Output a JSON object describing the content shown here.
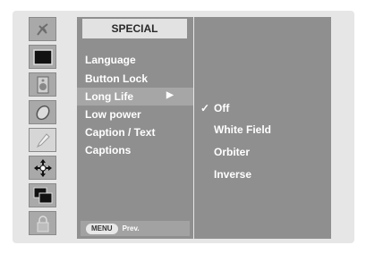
{
  "osd": {
    "menu_title": "SPECIAL",
    "menu_items": [
      {
        "label": "Language"
      },
      {
        "label": "Button Lock"
      },
      {
        "label": "Long Life",
        "arrow": "▶"
      },
      {
        "label": "Low power"
      },
      {
        "label": "Caption / Text"
      },
      {
        "label": "Captions"
      }
    ],
    "active_item": "Long Life",
    "footer": {
      "button": "MENU",
      "label": "Prev."
    },
    "sub_menu": {
      "items": [
        {
          "label": "Off",
          "check": "✓"
        },
        {
          "label": "White Field",
          "check": ""
        },
        {
          "label": "Orbiter",
          "check": ""
        },
        {
          "label": "Inverse",
          "check": ""
        }
      ]
    },
    "icons": [
      "antenna-icon",
      "picture-icon",
      "speaker-icon",
      "clock-icon",
      "special-icon",
      "screen-adjust-icon",
      "pip-icon",
      "lock-icon"
    ],
    "selected_icon": "special-icon"
  }
}
